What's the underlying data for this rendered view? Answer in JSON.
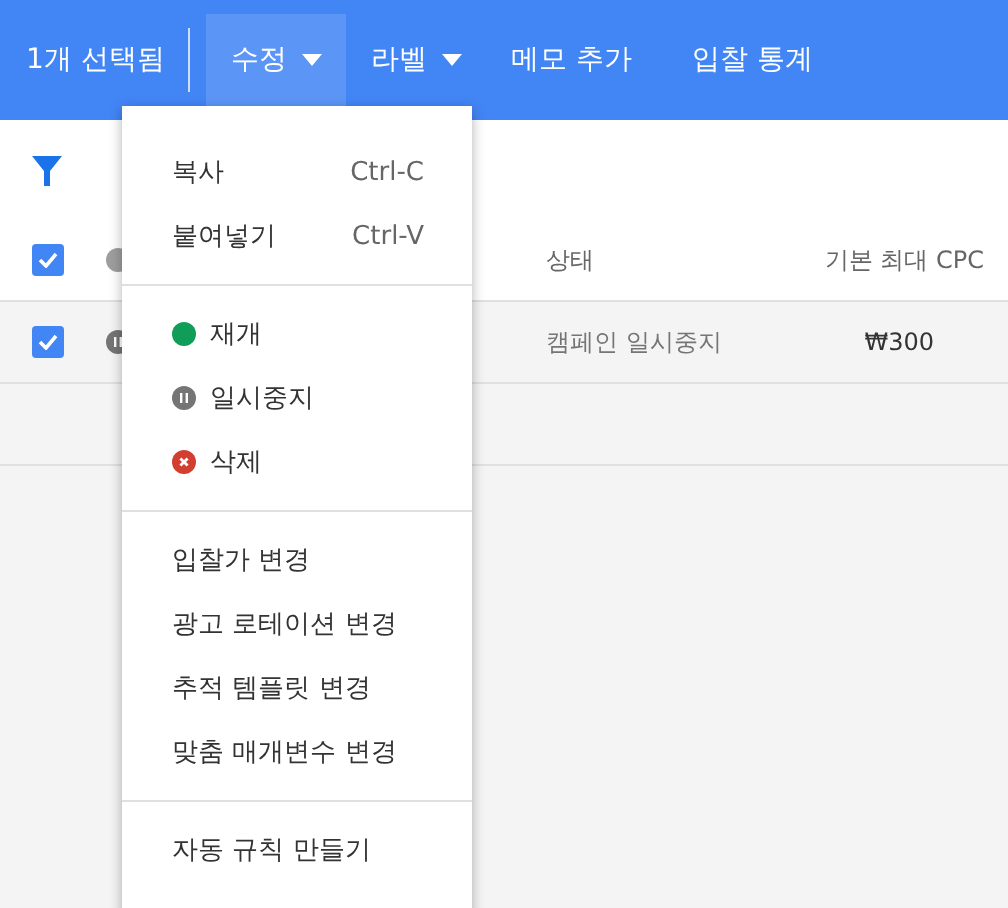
{
  "toolbar": {
    "selection": "1개 선택됨",
    "actions": [
      {
        "label": "수정",
        "dropdown": true,
        "selected": true
      },
      {
        "label": "라벨",
        "dropdown": true,
        "selected": false
      },
      {
        "label": "메모 추가",
        "dropdown": false,
        "selected": false
      },
      {
        "label": "입찰 통계",
        "dropdown": false,
        "selected": false
      }
    ]
  },
  "table": {
    "header": {
      "checked": true,
      "columns": [
        "상태",
        "기본 최대 CPC"
      ]
    },
    "rows": [
      {
        "checked": true,
        "kind": "paused",
        "cells": [
          "캠페인 일시중지",
          "₩300"
        ]
      }
    ]
  },
  "menu": {
    "sections": [
      {
        "items": [
          {
            "kind": "shortcut",
            "label": "복사",
            "shortcut": "Ctrl-C"
          },
          {
            "kind": "shortcut",
            "label": "붙여넣기",
            "shortcut": "Ctrl-V"
          }
        ]
      },
      {
        "items": [
          {
            "kind": "enabled",
            "label": "재개"
          },
          {
            "kind": "paused",
            "label": "일시중지"
          },
          {
            "kind": "removed",
            "label": "삭제"
          }
        ]
      },
      {
        "items": [
          {
            "kind": "plain",
            "label": "입찰가 변경"
          },
          {
            "kind": "plain",
            "label": "광고 로테이션 변경"
          },
          {
            "kind": "plain",
            "label": "추적 템플릿 변경"
          },
          {
            "kind": "plain",
            "label": "맞춤 매개변수 변경"
          }
        ]
      },
      {
        "items": [
          {
            "kind": "plain",
            "label": "자동 규칙 만들기"
          }
        ]
      }
    ]
  }
}
